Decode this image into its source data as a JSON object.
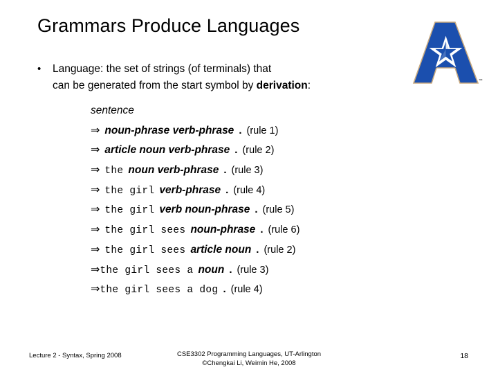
{
  "slide": {
    "title": "Grammars Produce Languages",
    "bullet": {
      "marker": "•",
      "line1": "Language: the set of strings (of terminals) that",
      "line2_pre": "can be generated from the start symbol by ",
      "line2_bold": "derivation",
      "line2_post": ":"
    },
    "derivation": {
      "start": "sentence",
      "arrow": "⇒",
      "period": ".",
      "steps": [
        {
          "arrow_gap": "wide",
          "parts": [
            {
              "kind": "nonterminal",
              "text": "noun-phrase verb-phrase"
            }
          ],
          "rule": "(rule 1)"
        },
        {
          "arrow_gap": "wide",
          "parts": [
            {
              "kind": "nonterminal",
              "text": "article noun verb-phrase"
            }
          ],
          "rule": "(rule 2)"
        },
        {
          "arrow_gap": "wide",
          "parts": [
            {
              "kind": "terminal",
              "text": "the"
            },
            {
              "kind": "nonterminal",
              "text": "noun verb-phrase"
            }
          ],
          "rule": "(rule 3)"
        },
        {
          "arrow_gap": "wide",
          "parts": [
            {
              "kind": "terminal",
              "text": "the girl"
            },
            {
              "kind": "nonterminal",
              "text": "verb-phrase"
            }
          ],
          "rule": "(rule 4)"
        },
        {
          "arrow_gap": "wide",
          "parts": [
            {
              "kind": "terminal",
              "text": "the girl"
            },
            {
              "kind": "nonterminal",
              "text": "verb noun-phrase"
            }
          ],
          "rule": "(rule 5)"
        },
        {
          "arrow_gap": "wide",
          "parts": [
            {
              "kind": "terminal",
              "text": "the girl sees"
            },
            {
              "kind": "nonterminal",
              "text": "noun-phrase"
            }
          ],
          "rule": "(rule 6)"
        },
        {
          "arrow_gap": "wide",
          "parts": [
            {
              "kind": "terminal",
              "text": "the  girl  sees"
            },
            {
              "kind": "nonterminal",
              "text": "article noun"
            }
          ],
          "rule": "(rule 2)"
        },
        {
          "arrow_gap": "tight",
          "parts": [
            {
              "kind": "terminal",
              "text": "the  girl  sees  a"
            },
            {
              "kind": "nonterminal",
              "text": "noun"
            }
          ],
          "rule": "(rule 3)"
        },
        {
          "arrow_gap": "tight",
          "parts": [
            {
              "kind": "terminal",
              "text": "the  girl  sees  a  dog"
            }
          ],
          "rule": "(rule 4)"
        }
      ]
    },
    "footer": {
      "left": "Lecture 2 - Syntax, Spring 2008",
      "center_line1": "CSE3302 Programming Languages, UT-Arlington",
      "center_line2": "©Chengkai Li, Weimin He, 2008",
      "page_number": "18"
    },
    "logo": {
      "name": "ut-arlington-a-logo",
      "trademark": "™",
      "blue": "#1B4FAE",
      "outline": "#C8A97E"
    }
  }
}
